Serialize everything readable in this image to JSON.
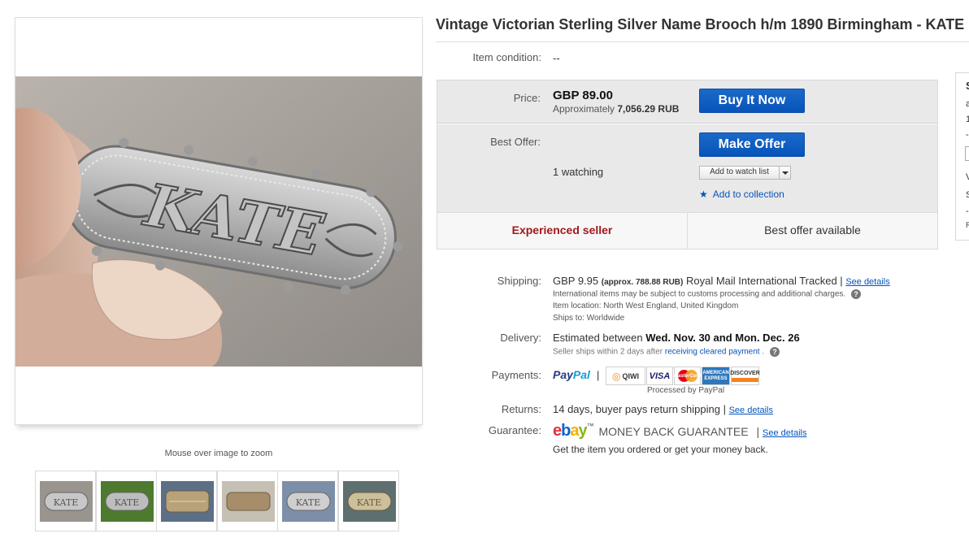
{
  "listing": {
    "title": "Vintage Victorian Sterling Silver Name Brooch h/m 1890 Birmingham - KATE",
    "image_engraving": "KATE"
  },
  "viewer": {
    "zoom_hint": "Mouse over image to zoom",
    "thumbnail_count": 6
  },
  "condition": {
    "label": "Item condition:",
    "value": "--"
  },
  "price": {
    "label": "Price:",
    "amount": "GBP 89.00",
    "approx_prefix": "Approximately",
    "approx_value": "7,056.29 RUB",
    "buy_button": "Buy It Now"
  },
  "offer": {
    "label": "Best Offer:",
    "button": "Make Offer",
    "watching": "1 watching",
    "watch_list": "Add to watch list",
    "add_collection": "Add to collection"
  },
  "badges": {
    "seller": "Experienced seller",
    "best_offer": "Best offer available"
  },
  "side_panel": {
    "fragments": [
      "S",
      "a",
      "1",
      "-",
      "V",
      "S",
      "-",
      "R"
    ]
  },
  "shipping": {
    "label": "Shipping:",
    "cost": "GBP 9.95",
    "approx": "(approx. 788.88 RUB)",
    "service": "Royal Mail International Tracked |",
    "details_link": "See details",
    "customs_note": "International items may be subject to customs processing and additional charges.",
    "location_label": "Item location:",
    "location": "North West England, United Kingdom",
    "ships_to_label": "Ships to:",
    "ships_to": "Worldwide"
  },
  "delivery": {
    "label": "Delivery:",
    "prefix": "Estimated between",
    "range": "Wed. Nov. 30 and Mon. Dec. 26",
    "sub_prefix": "Seller ships within 2 days after",
    "sub_link": "receiving cleared payment",
    "sub_suffix": "."
  },
  "payments": {
    "label": "Payments:",
    "paypal_1": "Pay",
    "paypal_2": "Pal",
    "separator": "|",
    "cards": [
      "QIWI",
      "VISA",
      "MasterCard",
      "AMERICAN EXPRESS",
      "DISCOVER"
    ],
    "processed": "Processed by PayPal"
  },
  "returns": {
    "label": "Returns:",
    "text": "14 days, buyer pays return shipping |",
    "details_link": "See details"
  },
  "guarantee": {
    "label": "Guarantee:",
    "logo_e": "e",
    "logo_b": "b",
    "logo_a": "a",
    "logo_y": "y",
    "tm": "™",
    "text": "MONEY BACK GUARANTEE",
    "separator": "|",
    "details_link": "See details",
    "sub": "Get the item you ordered or get your money back."
  },
  "icons": {
    "help": "question-icon",
    "star": "star-icon",
    "caret": "chevron-down-icon"
  }
}
